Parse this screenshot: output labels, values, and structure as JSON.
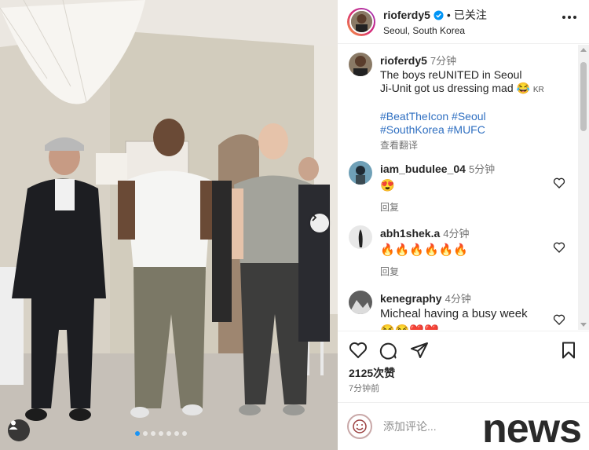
{
  "post": {
    "username": "rioferdy5",
    "follow_status": "已关注",
    "location": "Seoul, South Korea"
  },
  "caption": {
    "username": "rioferdy5",
    "time": "7分钟",
    "line1": "The boys reUNITED in Seoul",
    "line2": "Ji-Unit got us dressing mad 😂",
    "flag": "KR",
    "hashtags_line1": "#BeatTheIcon #Seoul",
    "hashtags_line2": "#SouthKorea #MUFC",
    "translate": "查看翻译"
  },
  "comments": [
    {
      "username": "iam_budulee_04",
      "time": "5分钟",
      "text": "😍",
      "reply": "回复"
    },
    {
      "username": "abh1shek.a",
      "time": "4分钟",
      "text": "🔥🔥🔥🔥🔥🔥",
      "reply": "回复"
    },
    {
      "username": "kenegraphy",
      "time": "4分钟",
      "text": "Micheal having a busy week",
      "text2": "😂😂❤️❤️"
    }
  ],
  "stats": {
    "likes": "2125次赞",
    "date": "7分钟前"
  },
  "comment_input": {
    "placeholder": "添加评论..."
  },
  "watermark": "news",
  "icons": {
    "verified": "verified-badge-icon",
    "more": "more-options-icon",
    "heart": "heart-icon",
    "comment": "comment-icon",
    "share": "share-icon",
    "save": "bookmark-icon",
    "next": "chevron-right-icon",
    "tag": "user-tag-icon",
    "emoji": "emoji-icon"
  },
  "colors": {
    "link": "#2f6fc1",
    "verified": "#0095f6",
    "active_dot": "#1a94f5"
  },
  "carousel": {
    "total": 7,
    "active": 1
  }
}
